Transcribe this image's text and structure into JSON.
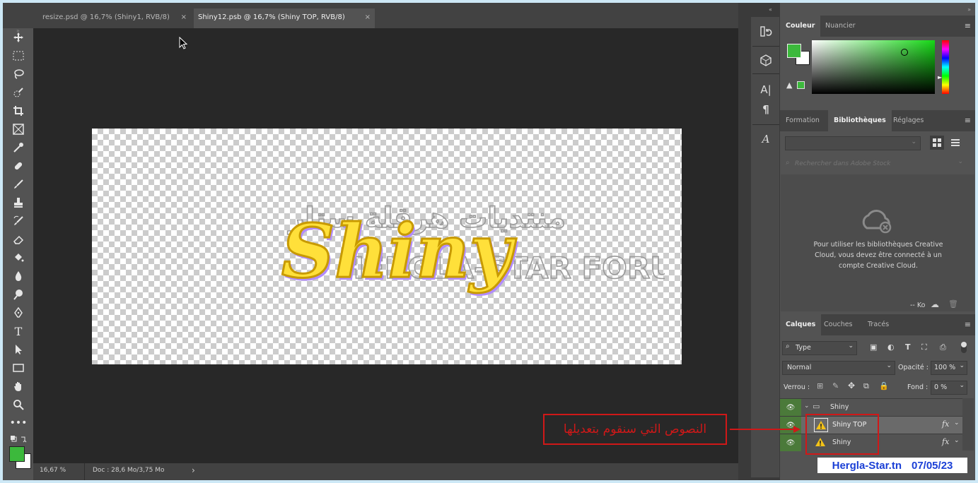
{
  "tabs": [
    {
      "label": "resize.psd @ 16,7% (Shiny1, RVB/8)",
      "close": "×"
    },
    {
      "label": "Shiny12.psb @ 16,7% (Shiny TOP, RVB/8)",
      "close": "×"
    }
  ],
  "tools": [
    "move-tool",
    "marquee-tool",
    "lasso-tool",
    "quick-select-tool",
    "crop-tool",
    "frame-tool",
    "eyedropper-tool",
    "healing-tool",
    "brush-tool",
    "stamp-tool",
    "history-brush-tool",
    "eraser-tool",
    "bucket-tool",
    "blur-tool",
    "dodge-tool",
    "pen-tool",
    "type-tool",
    "path-select-tool",
    "rectangle-tool",
    "hand-tool",
    "zoom-tool",
    "more-tools"
  ],
  "canvas": {
    "art_script": "Shiny",
    "watermark_arabic": "منتديات هرقلة ستار",
    "watermark_latin": "HERGLA-STAR FORUMS"
  },
  "status": {
    "zoom": "16,67 %",
    "doc": "Doc : 28,6 Mo/3,75 Mo",
    "arrow": "›"
  },
  "color_panel": {
    "tabs": [
      "Couleur",
      "Nuancier"
    ],
    "foreground": "#3cb93c",
    "background": "#ffffff"
  },
  "libraries_panel": {
    "tabs": [
      "Formation",
      "Bibliothèques",
      "Réglages"
    ],
    "search_placeholder": "Rechercher dans Adobe Stock",
    "message": "Pour utiliser les bibliothèques Creative Cloud, vous devez être connecté à un compte Creative Cloud.",
    "footer_size": "-- Ko"
  },
  "layers_panel": {
    "tabs": [
      "Calques",
      "Couches",
      "Tracés"
    ],
    "filter_label": "Type",
    "blend_mode": "Normal",
    "opacity_label": "Opacité :",
    "opacity_value": "100 %",
    "lock_label": "Verrou :",
    "fill_label": "Fond :",
    "fill_value": "0 %",
    "layers": [
      {
        "name": "Shiny",
        "type": "group"
      },
      {
        "name": "Shiny TOP",
        "type": "smart",
        "fx": "fx"
      },
      {
        "name": "Shiny",
        "type": "smart",
        "fx": "fx"
      }
    ]
  },
  "annotation": {
    "text": "النصوص التي سنقوم بتعديلها",
    "color": "#d01818"
  },
  "watermark": {
    "site": "Hergla-Star.tn",
    "date": "07/05/23"
  }
}
